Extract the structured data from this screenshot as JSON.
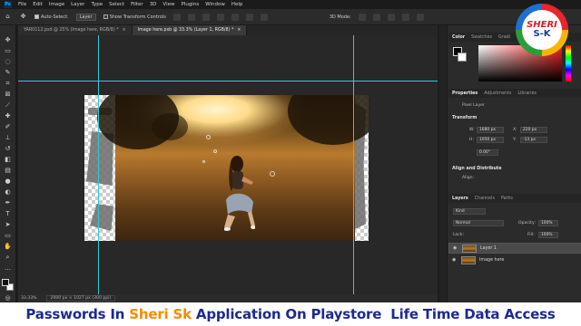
{
  "menubar": {
    "app_logo": "Ps",
    "items": [
      "File",
      "Edit",
      "Image",
      "Layer",
      "Type",
      "Select",
      "Filter",
      "3D",
      "View",
      "Plugins",
      "Window",
      "Help"
    ]
  },
  "options": {
    "auto_select_label": "Auto-Select:",
    "auto_select_value": "Layer",
    "show_transform_label": "Show Transform Controls",
    "mode_3d_label": "3D Mode:"
  },
  "tabs": [
    {
      "label": "YAR0112.psd @ 25% (Image here, RGB/8) *",
      "close": "×"
    },
    {
      "label": "Image here.psb @ 33.3% (Layer 1, RGB/8) *",
      "close": "×"
    }
  ],
  "status": {
    "zoom": "33.33%",
    "doc_info": "2000 px × 1027 px (300 ppi)"
  },
  "panels": {
    "color_tabs": [
      "Color",
      "Swatches",
      "Gradi"
    ],
    "properties_tabs": [
      "Properties",
      "Adjustments",
      "Libraries"
    ],
    "pixel_layer_label": "Pixel Layer",
    "transform_label": "Transform",
    "w_label": "W:",
    "w_value": "1680 px",
    "h_label": "H:",
    "h_value": "1050 px",
    "x_label": "X:",
    "x_value": "220 px",
    "y_label": "Y:",
    "y_value": "-13 px",
    "angle_value": "0.00°",
    "align_label": "Align and Distribute",
    "align_sub": "Align:",
    "layers_tabs": [
      "Layers",
      "Channels",
      "Paths"
    ],
    "kind_label": "Kind",
    "blend_mode": "Normal",
    "opacity_label": "Opacity:",
    "opacity_value": "100%",
    "lock_label": "Lock:",
    "fill_label": "Fill:",
    "fill_value": "100%",
    "layers": [
      {
        "name": "Layer 1",
        "selected": true
      },
      {
        "name": "Image here",
        "selected": false
      }
    ]
  },
  "logo": {
    "line1": "SHERI",
    "line2": "S-K"
  },
  "caption": {
    "before": "Passwords In ",
    "highlight": "Sheri Sk",
    "after": " Application On Playstore  Life Time Data Access"
  },
  "colors": {
    "guide": "#39c7d3",
    "caption_text": "#1d2a8f",
    "caption_highlight": "#f28c00"
  }
}
